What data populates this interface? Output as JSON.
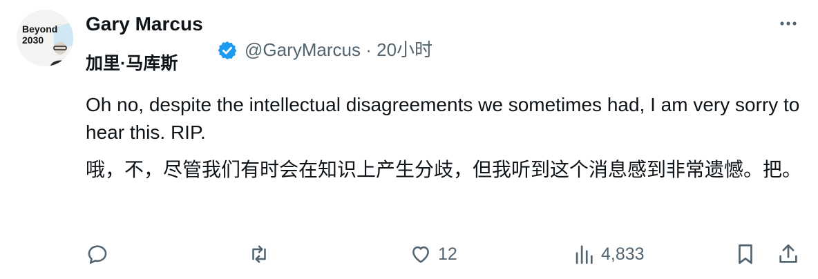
{
  "author": {
    "name": "Gary Marcus",
    "chinese_name": "加里·马库斯",
    "handle": "@GaryMarcus",
    "separator": "·",
    "timestamp": "20小时",
    "avatar_text": [
      "Beyond",
      "2030"
    ]
  },
  "tweet": {
    "text_en": "Oh no, despite the intellectual disagreements we sometimes had, I am very sorry to hear this. RIP.",
    "text_cn": "哦，不，尽管我们有时会在知识上产生分歧，但我听到这个消息感到非常遗憾。把。"
  },
  "actions": {
    "likes": "12",
    "views": "4,833"
  },
  "colors": {
    "text": "#0f1419",
    "secondary": "#536471",
    "verified": "#1d9bf0"
  },
  "icons": [
    "verified-badge-icon",
    "more-icon",
    "reply-icon",
    "retweet-icon",
    "like-icon",
    "views-icon",
    "bookmark-icon",
    "share-icon"
  ]
}
